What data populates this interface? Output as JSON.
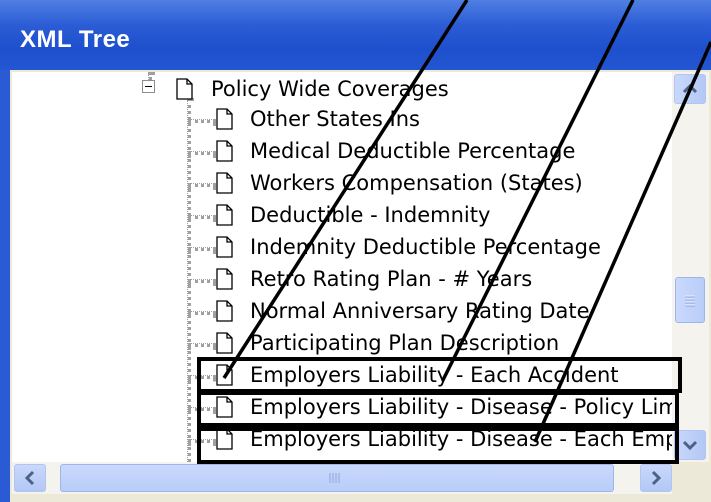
{
  "window": {
    "title": "XML Tree"
  },
  "tree": {
    "parent": {
      "label": "Policy Wide Coverages",
      "expanded": true
    },
    "children": [
      {
        "label": "Other States Ins"
      },
      {
        "label": "Medical Deductible Percentage"
      },
      {
        "label": "Workers Compensation (States)"
      },
      {
        "label": "Deductible - Indemnity"
      },
      {
        "label": "Indemnity Deductible Percentage"
      },
      {
        "label": "Retro Rating Plan - # Years"
      },
      {
        "label": "Normal Anniversary Rating Date"
      },
      {
        "label": "Participating Plan Description"
      },
      {
        "label": "Employers Liability - Each Accident",
        "highlighted": true
      },
      {
        "label": "Employers Liability - Disease - Policy Limit",
        "highlighted": true
      },
      {
        "label": "Employers Liability - Disease - Each Employee",
        "highlighted": true
      }
    ]
  },
  "icons": {
    "expander": "minus-box-icon",
    "node": "document-icon",
    "scroll_up": "arrow-up-icon",
    "scroll_down": "arrow-down-icon",
    "scroll_left": "arrow-left-icon",
    "scroll_right": "arrow-right-icon"
  },
  "colors": {
    "titlebar": "#2456d2",
    "annotation": "#000000"
  }
}
